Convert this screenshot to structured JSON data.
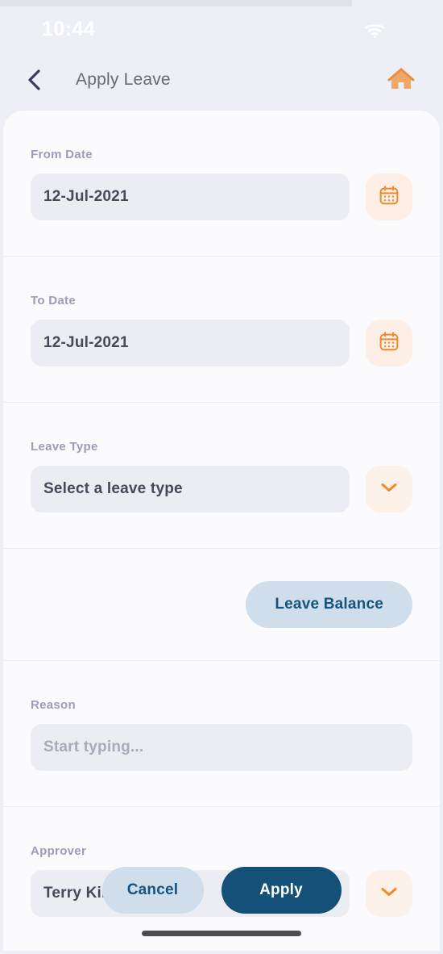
{
  "status_bar": {
    "time": "10:44",
    "wifi_icon": "wifi-icon"
  },
  "nav": {
    "back_icon": "chevron-left-icon",
    "title": "Apply Leave",
    "home_icon": "home-icon"
  },
  "form": {
    "fields": [
      {
        "label": "From Date",
        "value": "12-Jul-2021",
        "trailing_icon": "calendar-icon"
      },
      {
        "label": "To Date",
        "value": "12-Jul-2021",
        "trailing_icon": "calendar-icon"
      },
      {
        "label": "Leave Type",
        "value": "Select a leave type",
        "trailing_icon": "chevron-down-icon"
      },
      {
        "label": "Reason",
        "value": "Start typing...",
        "trailing_icon": ""
      },
      {
        "label": "Approver",
        "value": "Terry Kinny",
        "trailing_icon": "chevron-down-icon"
      }
    ],
    "leave_balance_label": "Leave Balance"
  },
  "footer": {
    "cancel_label": "Cancel",
    "apply_label": "Apply"
  },
  "colors": {
    "accent_orange": "#ee7f22",
    "accent_navy": "#145078",
    "icon_bg_peach": "#fdefe5",
    "field_bg": "#ebedf3",
    "label_gray": "#9a9cba",
    "page_bg": "#eeeff4",
    "card_bg": "#fbfbfd"
  }
}
